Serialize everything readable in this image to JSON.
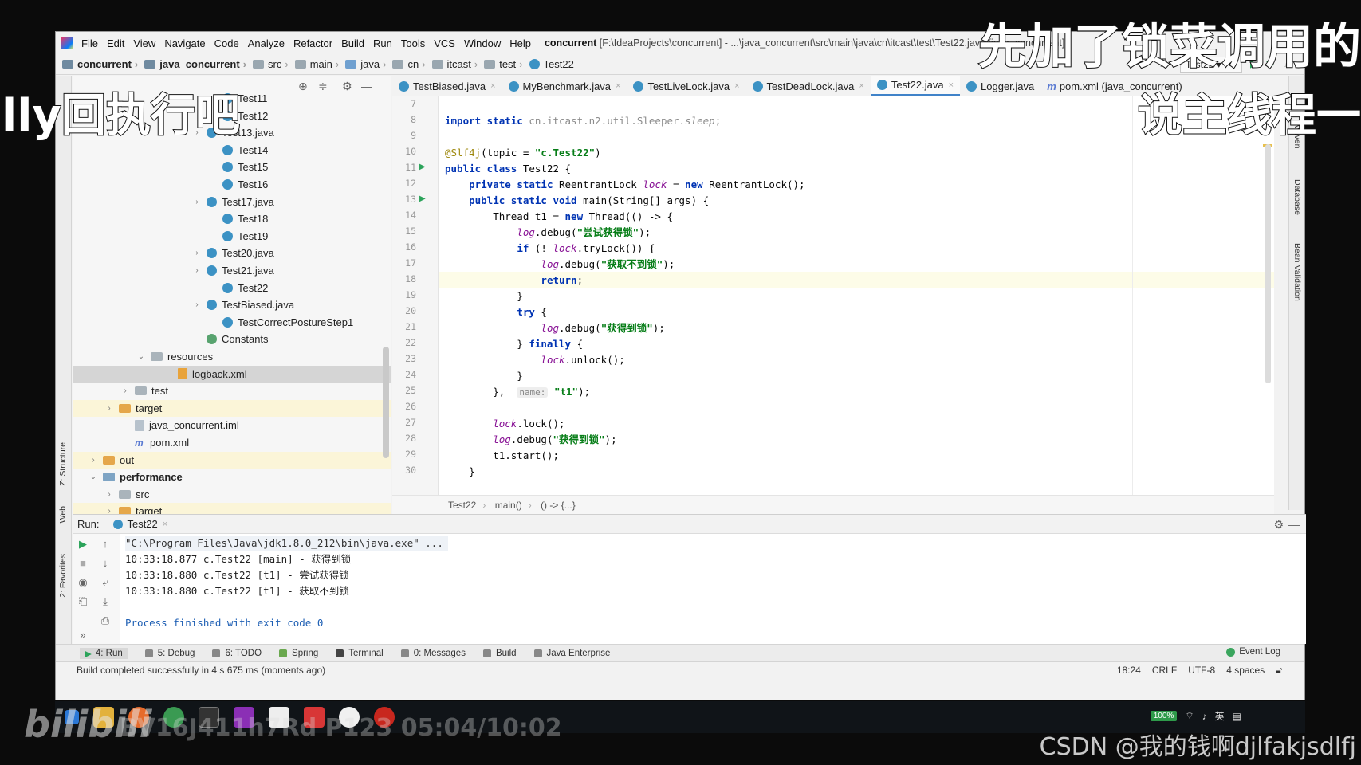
{
  "menu": {
    "items": [
      "File",
      "Edit",
      "View",
      "Navigate",
      "Code",
      "Analyze",
      "Refactor",
      "Build",
      "Run",
      "Tools",
      "VCS",
      "Window",
      "Help"
    ],
    "project_name": "concurrent",
    "path": "[F:\\IdeaProjects\\concurrent] - ...\\java_concurrent\\src\\main\\java\\cn\\itcast\\test\\Test22.java [java_concurrent]"
  },
  "breadcrumb": {
    "items": [
      "concurrent",
      "java_concurrent",
      "src",
      "main",
      "java",
      "cn",
      "itcast",
      "test",
      "Test22"
    ],
    "run_config": "Test22"
  },
  "project_tree": {
    "rows": [
      {
        "label": "Test11",
        "kind": "class"
      },
      {
        "label": "Test12",
        "kind": "class"
      },
      {
        "label": "Test13.java",
        "kind": "class",
        "arrow": "›"
      },
      {
        "label": "Test14",
        "kind": "class"
      },
      {
        "label": "Test15",
        "kind": "class"
      },
      {
        "label": "Test16",
        "kind": "class"
      },
      {
        "label": "Test17.java",
        "kind": "class",
        "arrow": "›"
      },
      {
        "label": "Test18",
        "kind": "class"
      },
      {
        "label": "Test19",
        "kind": "class"
      },
      {
        "label": "Test20.java",
        "kind": "class",
        "arrow": "›"
      },
      {
        "label": "Test21.java",
        "kind": "class",
        "arrow": "›"
      },
      {
        "label": "Test22",
        "kind": "class"
      },
      {
        "label": "TestBiased.java",
        "kind": "class",
        "arrow": "›"
      },
      {
        "label": "TestCorrectPostureStep1",
        "kind": "class"
      },
      {
        "label": "Constants",
        "kind": "const"
      },
      {
        "label": "resources",
        "kind": "folder",
        "arrow": "⌄"
      },
      {
        "label": "logback.xml",
        "kind": "file"
      },
      {
        "label": "test",
        "kind": "folder",
        "arrow": "›"
      },
      {
        "label": "target",
        "kind": "folder-orange",
        "arrow": "›"
      },
      {
        "label": "java_concurrent.iml",
        "kind": "iml"
      },
      {
        "label": "pom.xml",
        "kind": "m"
      },
      {
        "label": "out",
        "kind": "folder-orange",
        "arrow": "›"
      },
      {
        "label": "performance",
        "kind": "folder-blue",
        "arrow": "⌄"
      },
      {
        "label": "src",
        "kind": "folder",
        "arrow": "›"
      },
      {
        "label": "target",
        "kind": "folder-orange",
        "arrow": "›"
      }
    ]
  },
  "editor_tabs": [
    "TestBiased.java",
    "MyBenchmark.java",
    "TestLiveLock.java",
    "TestDeadLock.java",
    "Test22.java",
    "Logger.java",
    "pom.xml (java_concurrent)"
  ],
  "editor": {
    "line_numbers": [
      "7",
      "8",
      "9",
      "10",
      "11",
      "12",
      "13",
      "14",
      "15",
      "16",
      "17",
      "18",
      "19",
      "20",
      "21",
      "22",
      "23",
      "24",
      "25",
      "26",
      "27",
      "28",
      "29",
      "30"
    ],
    "code_breadcrumb": [
      "Test22",
      "main()",
      "() -> {...}"
    ]
  },
  "run_panel": {
    "label": "Run:",
    "tab": "Test22",
    "console": [
      "\"C:\\Program Files\\Java\\jdk1.8.0_212\\bin\\java.exe\" ...",
      "10:33:18.877 c.Test22 [main] - 获得到锁",
      "10:33:18.880 c.Test22 [t1] - 尝试获得锁",
      "10:33:18.880 c.Test22 [t1] - 获取不到锁",
      "",
      "Process finished with exit code 0"
    ]
  },
  "tool_tabs": [
    "4: Run",
    "5: Debug",
    "6: TODO",
    "Spring",
    "Terminal",
    "0: Messages",
    "Build",
    "Java Enterprise"
  ],
  "event_log": "Event Log",
  "status": {
    "message": "Build completed successfully in 4 s 675 ms (moments ago)",
    "position": "18:24",
    "line_sep": "CRLF",
    "encoding": "UTF-8",
    "indent": "4 spaces"
  },
  "side_tabs": {
    "left": [
      "Z: Structure",
      "Web",
      "2: Favorites"
    ],
    "right": [
      "Maven",
      "Database",
      "Bean Validation"
    ]
  },
  "taskbar": {
    "battery": "100%",
    "ime": "英"
  },
  "overlay": {
    "subtitle_top_right": "先加了锁菜调用的",
    "subtitle_left": "lly回执行吧",
    "subtitle_right": "说主线程一",
    "bili_logo": "bilibili",
    "bili_id": "BV16J411h7Rd P123 05:04/10:02",
    "watermark": "CSDN @我的钱啊djlfakjsdlfj"
  }
}
